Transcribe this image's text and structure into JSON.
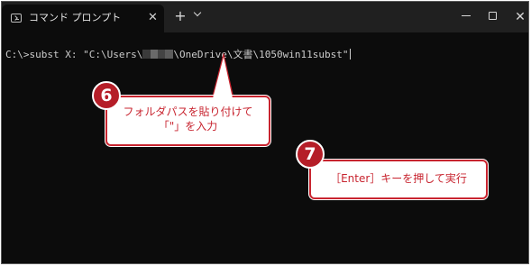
{
  "titlebar": {
    "tab_title": "コマンド プロンプト",
    "tab_close": "✕",
    "new_tab": "+",
    "close": "✕"
  },
  "console": {
    "line_prefix": "C:\\>subst X: \"C:\\Users\\",
    "line_suffix": "\\OneDrive\\文書\\1050win11subst\""
  },
  "annotations": [
    {
      "number": "6",
      "text_line1": "フォルダパスを貼り付けて",
      "text_line2": "「\"」を入力"
    },
    {
      "number": "7",
      "text": "［Enter］キーを押して実行"
    }
  ],
  "colors": {
    "accent": "#c8242f",
    "badge": "#b51e28",
    "terminal_bg": "#0c0c0c",
    "titlebar_bg": "#202020"
  }
}
